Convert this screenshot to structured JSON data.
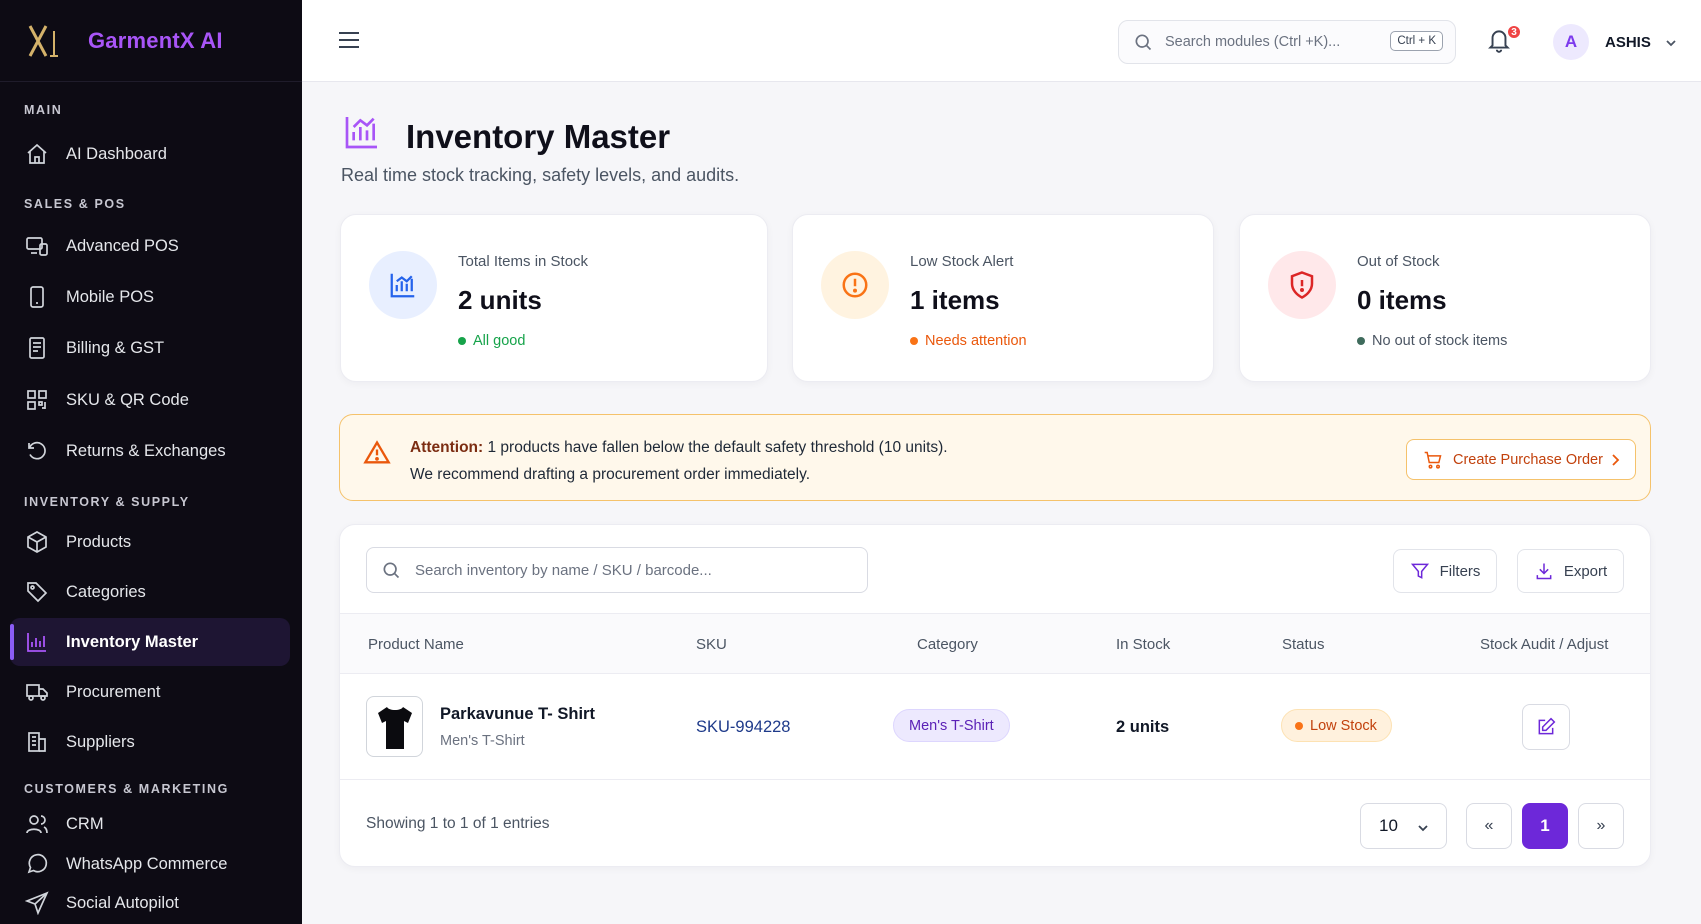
{
  "brand": {
    "name": "GarmentX AI",
    "logo_text": "XI"
  },
  "sidebar": {
    "sections": [
      {
        "title": "MAIN"
      },
      {
        "title": "SALES & POS"
      },
      {
        "title": "INVENTORY & SUPPLY"
      },
      {
        "title": "CUSTOMERS & MARKETING"
      }
    ],
    "items": [
      {
        "label": "AI Dashboard",
        "icon": "home-icon"
      },
      {
        "label": "Advanced POS",
        "icon": "pos-devices-icon"
      },
      {
        "label": "Mobile POS",
        "icon": "mobile-icon"
      },
      {
        "label": "Billing & GST",
        "icon": "receipt-icon"
      },
      {
        "label": "SKU & QR Code",
        "icon": "qr-code-icon"
      },
      {
        "label": "Returns & Exchanges",
        "icon": "rotate-ccw-icon"
      },
      {
        "label": "Products",
        "icon": "package-icon"
      },
      {
        "label": "Categories",
        "icon": "tag-icon"
      },
      {
        "label": "Inventory Master",
        "icon": "bar-chart-icon",
        "active": true
      },
      {
        "label": "Procurement",
        "icon": "truck-icon"
      },
      {
        "label": "Suppliers",
        "icon": "building-icon"
      },
      {
        "label": "CRM",
        "icon": "users-icon"
      },
      {
        "label": "WhatsApp Commerce",
        "icon": "whatsapp-icon"
      },
      {
        "label": "Social Autopilot",
        "icon": "send-icon"
      }
    ]
  },
  "topbar": {
    "search_placeholder": "Search modules (Ctrl +K)...",
    "shortcut": "Ctrl + K",
    "notification_count": "3",
    "avatar_initial": "A",
    "username": "ASHIS"
  },
  "page": {
    "title": "Inventory Master",
    "subtitle": "Real time stock tracking, safety levels, and audits."
  },
  "stats": [
    {
      "label": "Total Items in Stock",
      "value": "2 units",
      "note": "All good",
      "color": "#16a34a",
      "icon": "bar-chart-icon"
    },
    {
      "label": "Low Stock Alert",
      "value": "1 items",
      "note": "Needs attention",
      "color": "#f97316",
      "icon": "alert-circle-icon"
    },
    {
      "label": "Out of Stock",
      "value": "0 items",
      "note": "No out of stock items",
      "color": "#4b5563",
      "icon": "shield-alert-icon"
    }
  ],
  "alert": {
    "title": "Attention:",
    "message": "1 products have fallen below the default safety threshold (10 units).",
    "recommendation": "We recommend drafting a procurement order immediately.",
    "button": "Create Purchase Order"
  },
  "table": {
    "search_placeholder": "Search inventory by name / SKU / barcode...",
    "filters_label": "Filters",
    "export_label": "Export",
    "columns": [
      "Product Name",
      "SKU",
      "Category",
      "In Stock",
      "Status",
      "Stock Audit / Adjust"
    ],
    "rows": [
      {
        "name": "Parkavunue T- Shirt",
        "subcategory": "Men's T-Shirt",
        "sku": "SKU-994228",
        "category": "Men's T-Shirt",
        "in_stock": "2 units",
        "status": "Low Stock"
      }
    ],
    "footer": {
      "showing": "Showing 1 to 1 of 1 entries",
      "page_size": "10",
      "prev": "«",
      "current_page": "1",
      "next": "»"
    }
  },
  "colors": {
    "accent": "#6d28d9",
    "sidebar_bg": "#0d0b14",
    "warning": "#f97316",
    "danger": "#dc2626",
    "success": "#16a34a"
  }
}
